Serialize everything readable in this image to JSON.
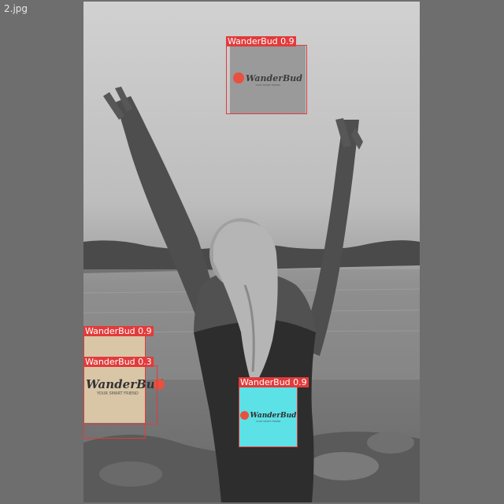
{
  "viewer": {
    "filename": "2.jpg"
  },
  "logo": {
    "brand": "WanderBud",
    "tagline": "YOUR SMART FRIEND"
  },
  "detections": [
    {
      "label": "WanderBud",
      "score": "0.9",
      "text": "WanderBud 0.9"
    },
    {
      "label": "WanderBud",
      "score": "0.9",
      "text": "WanderBud 0.9"
    },
    {
      "label": "WanderBud",
      "score": "0.3",
      "text": "WanderBud 0.3"
    },
    {
      "label": "WanderBud",
      "score": "0.9",
      "text": "WanderBud 0.9"
    }
  ],
  "colors": {
    "box": "#e23b3b",
    "logo_gray_bg": "#9a9a9a",
    "logo_beige_bg": "#d8c6a6",
    "logo_cyan_bg": "#5ce1e6",
    "logo_accent": "#e8503f"
  }
}
